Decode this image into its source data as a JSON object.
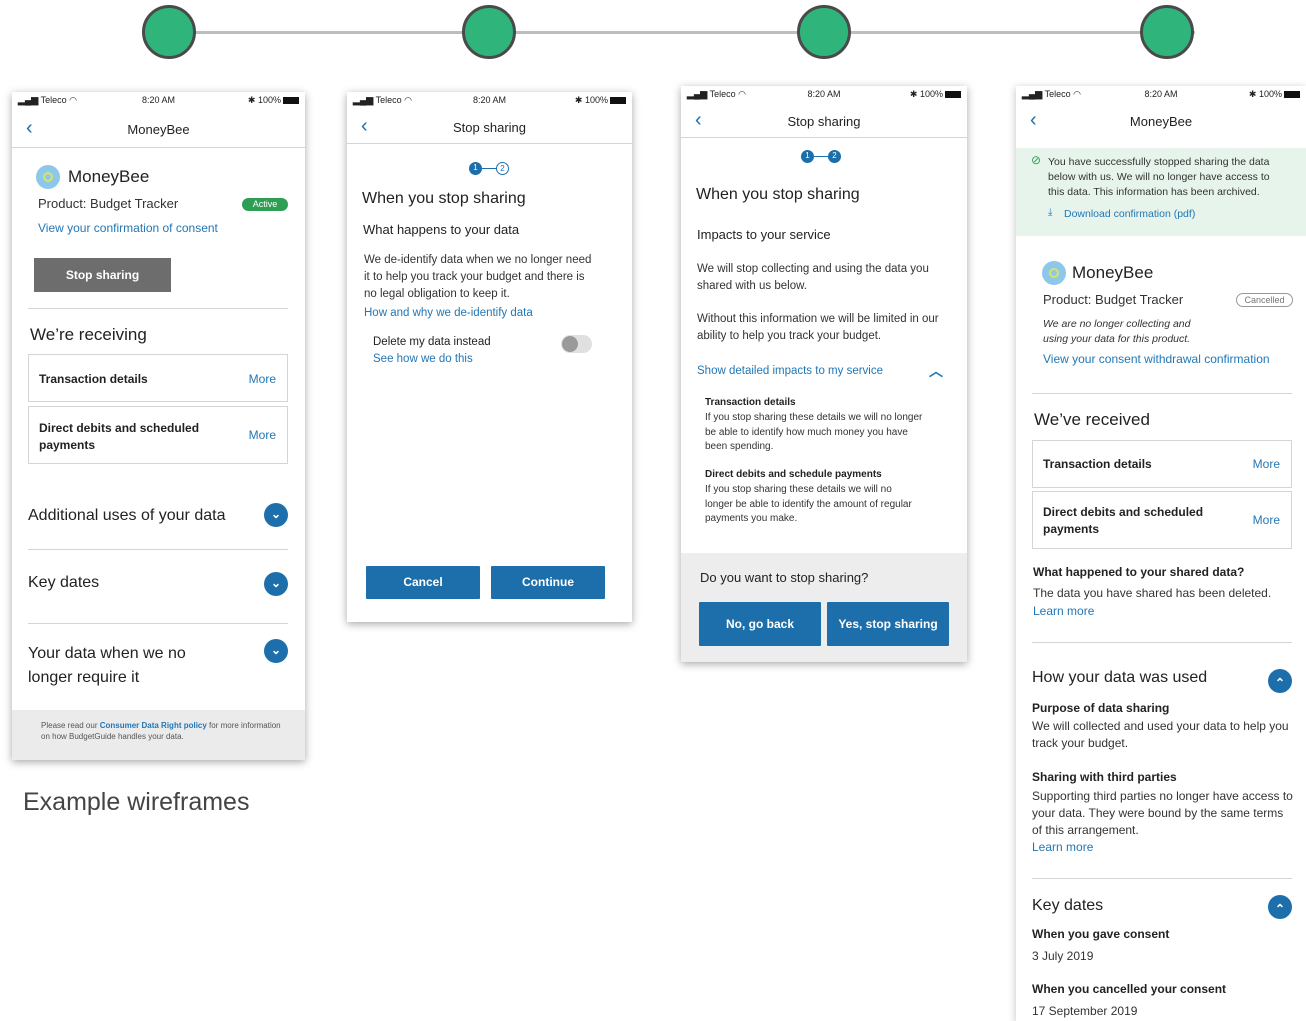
{
  "status": {
    "carrier": "Teleco",
    "time": "8:20 AM",
    "battery": "100%"
  },
  "caption": "Example wireframes",
  "screen1": {
    "nav_title": "MoneyBee",
    "brand": "MoneyBee",
    "product": "Product: Budget Tracker",
    "badge": "Active",
    "consent_link": "View your confirmation of consent",
    "stop_button": "Stop sharing",
    "receiving_heading": "We’re receiving",
    "items": [
      {
        "label": "Transaction details",
        "more": "More"
      },
      {
        "label": "Direct debits and scheduled payments",
        "more": "More"
      }
    ],
    "accordions": [
      "Additional uses of your data",
      "Key dates",
      "Your data when we no longer require it"
    ],
    "footer_pre": "Please read our ",
    "footer_link": "Consumer Data Right policy",
    "footer_post": " for more information on how BudgetGuide handles your data."
  },
  "screen2": {
    "nav_title": "Stop sharing",
    "step1": "1",
    "step2": "2",
    "heading": "When you stop sharing",
    "subheading": "What happens to your data",
    "body": "We de-identify data when we no longer need it to help you track your budget and there is no legal obligation to keep it.",
    "link": "How and why we de-identify data",
    "toggle_label": "Delete my data instead",
    "toggle_link": "See how we do this",
    "cancel": "Cancel",
    "continue": "Continue"
  },
  "screen3": {
    "nav_title": "Stop sharing",
    "step1": "1",
    "step2": "2",
    "heading": "When you stop sharing",
    "subheading": "Impacts to your service",
    "p1": "We will stop collecting and using the data you shared with us below.",
    "p2": "Without this information we will be limited in our ability to help you track your budget.",
    "show_link": "Show detailed impacts to my service",
    "d1_title": "Transaction details",
    "d1_body": "If you stop sharing these details we will no longer be able to identify how much money you have been spending.",
    "d2_title": "Direct debits and schedule payments",
    "d2_body": "If you stop sharing these details we will no longer be able to identify the amount of regular payments you make.",
    "question": "Do you want to stop sharing?",
    "no_button": "No, go back",
    "yes_button": "Yes, stop sharing"
  },
  "screen4": {
    "nav_title": "MoneyBee",
    "success": "You have successfully stopped sharing the data below with us. We will no longer have access to this data. This information has been archived.",
    "download": "Download confirmation (pdf)",
    "brand": "MoneyBee",
    "product": "Product: Budget Tracker",
    "badge": "Cancelled",
    "note": "We are no longer collecting and using your data for this product.",
    "withdrawal_link": "View your consent withdrawal confirmation",
    "received_heading": "We’ve received",
    "items": [
      {
        "label": "Transaction details",
        "more": "More"
      },
      {
        "label": "Direct debits and scheduled payments",
        "more": "More"
      }
    ],
    "happened_title": "What happened to your shared data?",
    "happened_body": "The data you have shared has been deleted.",
    "learn_more": "Learn more",
    "used_heading": "How your data was used",
    "purpose_title": "Purpose of data sharing",
    "purpose_body": "We will collected and used your data to help you track your budget.",
    "third_title": "Sharing with third parties",
    "third_body": "Supporting third parties no longer have access to your data. They were bound by the same terms of this arrangement.",
    "learn_more2": "Learn more",
    "keydates_heading": "Key dates",
    "gave_title": "When you gave consent",
    "gave_date": "3 July 2019",
    "cancelled_title": "When you cancelled your consent",
    "cancelled_date": "17 September 2019"
  },
  "colors": {
    "accent": "#1d6fab",
    "success": "#2fb57c",
    "link": "#2277b6"
  }
}
